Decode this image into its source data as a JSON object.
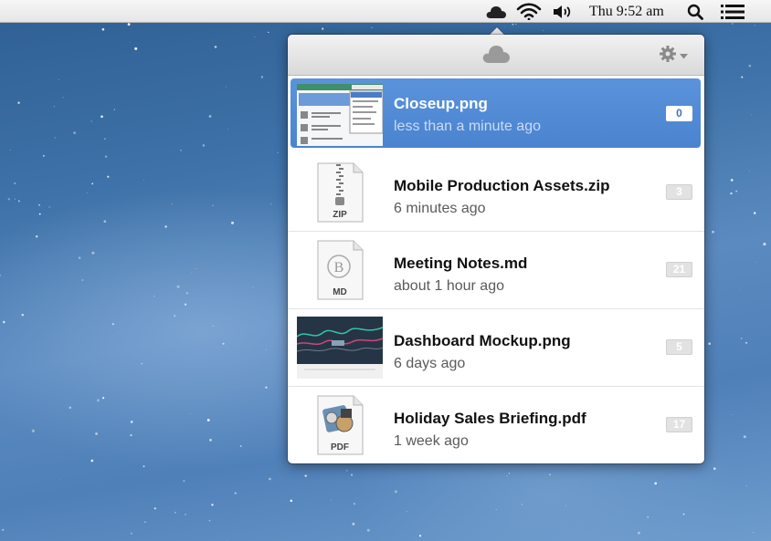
{
  "menubar": {
    "clock": "Thu 9:52 am",
    "icons": [
      "cloud-icon",
      "wifi-icon",
      "volume-icon",
      "search-icon",
      "list-icon"
    ]
  },
  "popover": {
    "header_icon": "cloud-icon",
    "settings_icon": "gear-icon",
    "files": [
      {
        "name": "Closeup.png",
        "time": "less than a minute ago",
        "views": "0",
        "thumb": "screenshot-thumbnail",
        "selected": true
      },
      {
        "name": "Mobile Production Assets.zip",
        "time": "6 minutes ago",
        "views": "3",
        "thumb": "zip-file-icon",
        "type_label": "ZIP"
      },
      {
        "name": "Meeting Notes.md",
        "time": "about 1 hour ago",
        "views": "21",
        "thumb": "markdown-file-icon",
        "type_label": "MD",
        "glyph": "B"
      },
      {
        "name": "Dashboard Mockup.png",
        "time": "6 days ago",
        "views": "5",
        "thumb": "dashboard-thumbnail"
      },
      {
        "name": "Holiday Sales Briefing.pdf",
        "time": "1 week ago",
        "views": "17",
        "thumb": "pdf-file-icon",
        "type_label": "PDF"
      }
    ]
  },
  "colors": {
    "selection": "#4a83cf",
    "badge": "#e2e2e2",
    "desktop": "#3e72a8"
  }
}
